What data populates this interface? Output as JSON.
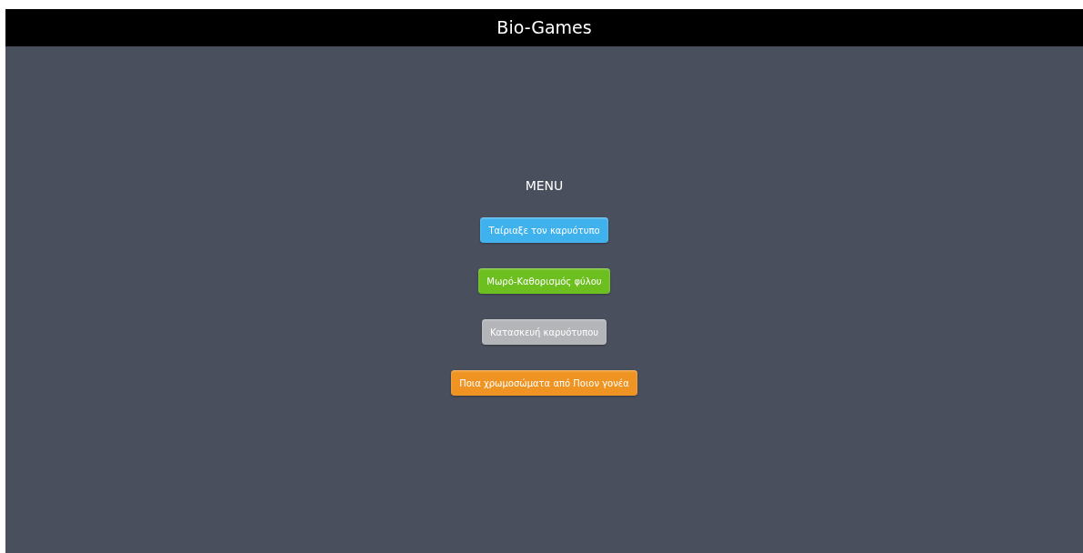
{
  "header": {
    "title": "Bio-Games"
  },
  "menu": {
    "title": "MENU",
    "buttons": [
      {
        "label": "Ταίριαξε τον καρυότυπο",
        "color": "#3fb2ee"
      },
      {
        "label": "Μωρό-Καθορισμός φύλου",
        "color": "#6cbf1f"
      },
      {
        "label": "Κατασκευή καρυότυπου",
        "color": "#b3b5b8"
      },
      {
        "label": "Ποια χρωμοσώματα από Ποιον γονέα",
        "color": "#ef9422"
      }
    ]
  }
}
